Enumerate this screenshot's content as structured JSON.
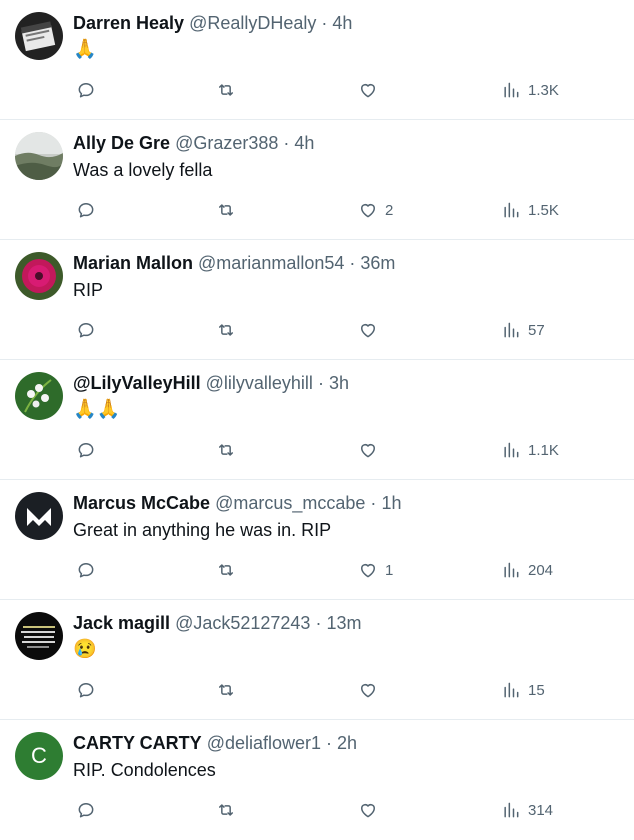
{
  "tweets": [
    {
      "name": "Darren Healy",
      "handle": "@ReallyDHealy",
      "separator": "·",
      "time": "4h",
      "text": "🙏",
      "likes": "",
      "views": "1.3K",
      "avatar": "clapperboard-avatar"
    },
    {
      "name": "Ally De Gre",
      "handle": "@Grazer388",
      "separator": "·",
      "time": "4h",
      "text": "Was a lovely fella",
      "likes": "2",
      "views": "1.5K",
      "avatar": "landscape-avatar"
    },
    {
      "name": "Marian Mallon",
      "handle": "@marianmallon54",
      "separator": "·",
      "time": "36m",
      "text": "RIP",
      "likes": "",
      "views": "57",
      "avatar": "flower-avatar"
    },
    {
      "name": "@LilyValleyHill",
      "handle": "@lilyvalleyhill",
      "separator": "·",
      "time": "3h",
      "text": "🙏🙏",
      "likes": "",
      "views": "1.1K",
      "avatar": "lily-avatar"
    },
    {
      "name": "Marcus McCabe",
      "handle": "@marcus_mccabe",
      "separator": "·",
      "time": "1h",
      "text": "Great in anything he was in. RIP",
      "likes": "1",
      "views": "204",
      "avatar": "m-logo-avatar"
    },
    {
      "name": "Jack magill",
      "handle": "@Jack52127243",
      "separator": "·",
      "time": "13m",
      "text": "😢",
      "likes": "",
      "views": "15",
      "avatar": "text-quote-avatar"
    },
    {
      "name": "CARTY CARTY",
      "handle": "@deliaflower1",
      "separator": "·",
      "time": "2h",
      "text": "RIP. Condolences",
      "likes": "",
      "views": "314",
      "avatar": "letter-avatar",
      "avatar_letter": "C"
    }
  ],
  "colors": {
    "secondary_text": "#536471",
    "divider": "#e6ecf0",
    "letter_avatar_bg": "#2e7d32"
  },
  "icons": [
    "reply-icon",
    "retweet-icon",
    "like-icon",
    "views-icon"
  ]
}
